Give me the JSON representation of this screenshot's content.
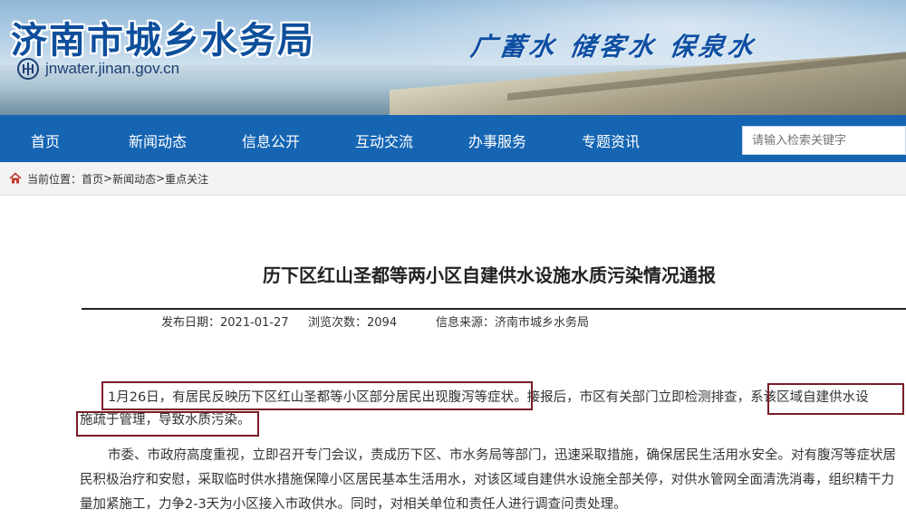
{
  "header": {
    "site_title": "济南市城乡水务局",
    "site_url": "jnwater.jinan.gov.cn",
    "slogan": "广蓄水 储客水 保泉水",
    "logo_icon": "water-bureau-logo-icon"
  },
  "nav": {
    "items": [
      {
        "label": "首页"
      },
      {
        "label": "新闻动态"
      },
      {
        "label": "信息公开"
      },
      {
        "label": "互动交流"
      },
      {
        "label": "办事服务"
      },
      {
        "label": "专题资讯"
      }
    ],
    "search_placeholder": "请输入检索关键字",
    "color": "#1565b3"
  },
  "breadcrumb": {
    "icon": "home-icon",
    "prefix": "当前位置：",
    "items": [
      "首页",
      "新闻动态",
      "重点关注"
    ],
    "separator": ">"
  },
  "article": {
    "title": "历下区红山圣都等两小区自建供水设施水质污染情况通报",
    "publish_date": "发布日期：2021-01-27",
    "views": "浏览次数：2094",
    "source": "信息来源：济南市城乡水务局",
    "para1": {
      "part1": "1月26日，有居民反映历下区红山圣都等小区部分居民出现腹泻等症状",
      "part2": "。接报后，市区有关部门立即检测排查，",
      "part3a": "系该区域自建供水设",
      "part3b": "施疏于管理，导致水质污染",
      "part4": "。"
    },
    "para2": "市委、市政府高度重视，立即召开专门会议，责成历下区、市水务局等部门，迅速采取措施，确保居民生活用水安全。对有腹泻等症状居民积极治疗和安慰，采取临时供水措施保障小区居民基本生活用水，对该区域自建供水设施全部关停，对供水管网全面清洗消毒，组织精干力量加紧施工，力争2-3天为小区接入市政供水。同时，对相关单位和责任人进行调查问责处理。",
    "highlight_color": "#7a1d28"
  }
}
